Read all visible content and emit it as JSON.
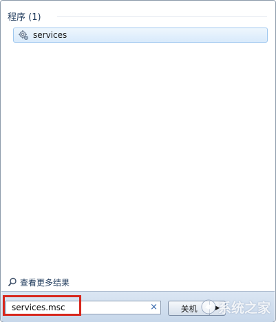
{
  "results": {
    "group_title": "程序 (1)",
    "items": [
      {
        "label": "services",
        "icon": "services-gear-icon"
      }
    ]
  },
  "more_results": {
    "label": "查看更多结果",
    "icon": "search-icon"
  },
  "search": {
    "value": "services.msc",
    "clear_glyph": "×"
  },
  "shutdown": {
    "label": "关机",
    "arrow_glyph": "▶"
  },
  "watermark": {
    "text": "系统之家"
  },
  "colors": {
    "highlight": "#d7261c",
    "accent": "#2a5fa8"
  }
}
